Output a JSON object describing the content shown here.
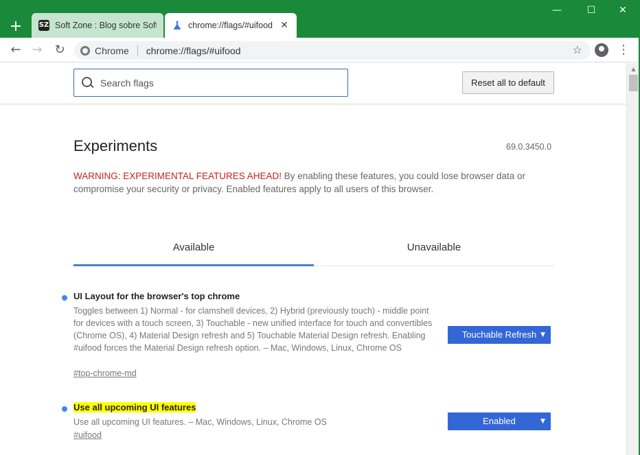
{
  "browser": {
    "tabs": [
      {
        "title": "Soft Zone : Blog sobre Softw",
        "favicon": "sz-logo-icon",
        "active": false
      },
      {
        "title": "chrome://flags/#uifood",
        "favicon": "flask-icon",
        "active": true
      }
    ],
    "new_tab": "+",
    "window_controls": {
      "minimize": "—",
      "maximize": "☐",
      "close": "✕"
    },
    "toolbar": {
      "back": "←",
      "forward": "→",
      "reload": "↻",
      "site_name": "Chrome",
      "url": "chrome://flags/#uifood",
      "star": "☆",
      "menu": "⋮"
    },
    "theme_color": "#1a8a3a"
  },
  "flags_page": {
    "search_placeholder": "Search flags",
    "reset_label": "Reset all to default",
    "title": "Experiments",
    "version": "69.0.3450.0",
    "warning_strong": "WARNING: EXPERIMENTAL FEATURES AHEAD!",
    "warning_text": " By enabling these features, you could lose browser data or compromise your security or privacy. Enabled features apply to all users of this browser.",
    "tabs": {
      "available": "Available",
      "unavailable": "Unavailable"
    },
    "flags": [
      {
        "name": "UI Layout for the browser's top chrome",
        "description": "Toggles between 1) Normal - for clamshell devices, 2) Hybrid (previously touch) - middle point for devices with a touch screen, 3) Touchable - new unified interface for touch and convertibles (Chrome OS), 4) Material Design refresh and 5) Touchable Material Design refresh. Enabling #uifood forces the Material Design refresh option. – Mac, Windows, Linux, Chrome OS",
        "link": "#top-chrome-md",
        "value": "Touchable Refresh"
      },
      {
        "name": "Use all upcoming UI features",
        "description": "Use all upcoming UI features. – Mac, Windows, Linux, Chrome OS",
        "link": "#uifood",
        "value": "Enabled"
      }
    ],
    "caret": "▼"
  }
}
